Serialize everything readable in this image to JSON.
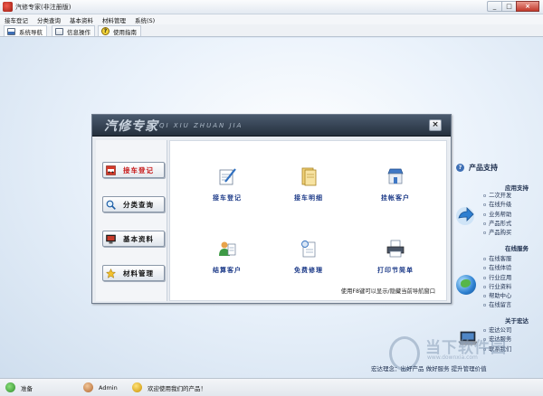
{
  "window": {
    "title": "汽修专家(非注册版)",
    "minimize": "_",
    "maximize": "□",
    "close": "×"
  },
  "menu": [
    "接车登记",
    "分类查询",
    "基本资料",
    "材料管理",
    "系统(S)"
  ],
  "tabs": [
    {
      "label": "系统导航",
      "icon": "nav-icon"
    },
    {
      "label": "信息操作",
      "icon": "info-icon"
    },
    {
      "label": "使用指南",
      "icon": "help-icon"
    }
  ],
  "dialog": {
    "title": "汽修专家",
    "subtitle": "QI XIU ZHUAN JIA",
    "close": "×",
    "nav": [
      {
        "label": "接车登记",
        "icon": "car-icon",
        "active": true
      },
      {
        "label": "分类查询",
        "icon": "magnifier-icon"
      },
      {
        "label": "基本资料",
        "icon": "monitor-icon"
      },
      {
        "label": "材料管理",
        "icon": "star-icon"
      }
    ],
    "functions": [
      {
        "label": "接车登记",
        "icon": "pen-paper-icon"
      },
      {
        "label": "接车明细",
        "icon": "folder-icon"
      },
      {
        "label": "挂帐客户",
        "icon": "shop-icon"
      },
      {
        "label": "结算客户",
        "icon": "users-icon"
      },
      {
        "label": "免费修理",
        "icon": "tools-icon"
      },
      {
        "label": "打印节简单",
        "icon": "printer-icon"
      }
    ],
    "hint": "使用F8键可以显示/隐藏当前导航窗口"
  },
  "right_panel": {
    "title": "产品支持",
    "sections": [
      {
        "title": "应用支持",
        "items": [
          "二次开发",
          "在线升级",
          "业务帮助",
          "产品形式",
          "产品购买"
        ]
      },
      {
        "title": "在线服务",
        "items": [
          "在线客服",
          "在线体验",
          "行业应用",
          "行业资料",
          "帮助中心",
          "在线留言"
        ]
      },
      {
        "title": "关于宏达",
        "items": [
          "宏达公司",
          "宏达服务",
          "联系我们"
        ]
      }
    ],
    "slogan": "宏达理念：出好产品  做好服务  提升管理价值"
  },
  "watermark": {
    "text": "当下软件园",
    "sub": "www.downxia.com"
  },
  "status": {
    "ready": "准备",
    "user": "Admin",
    "welcome": "欢迎使用我们的产品！"
  },
  "colors": {
    "accent": "#1c3a88",
    "active_nav": "#c81d1d",
    "dialog_title": "#25303d"
  }
}
